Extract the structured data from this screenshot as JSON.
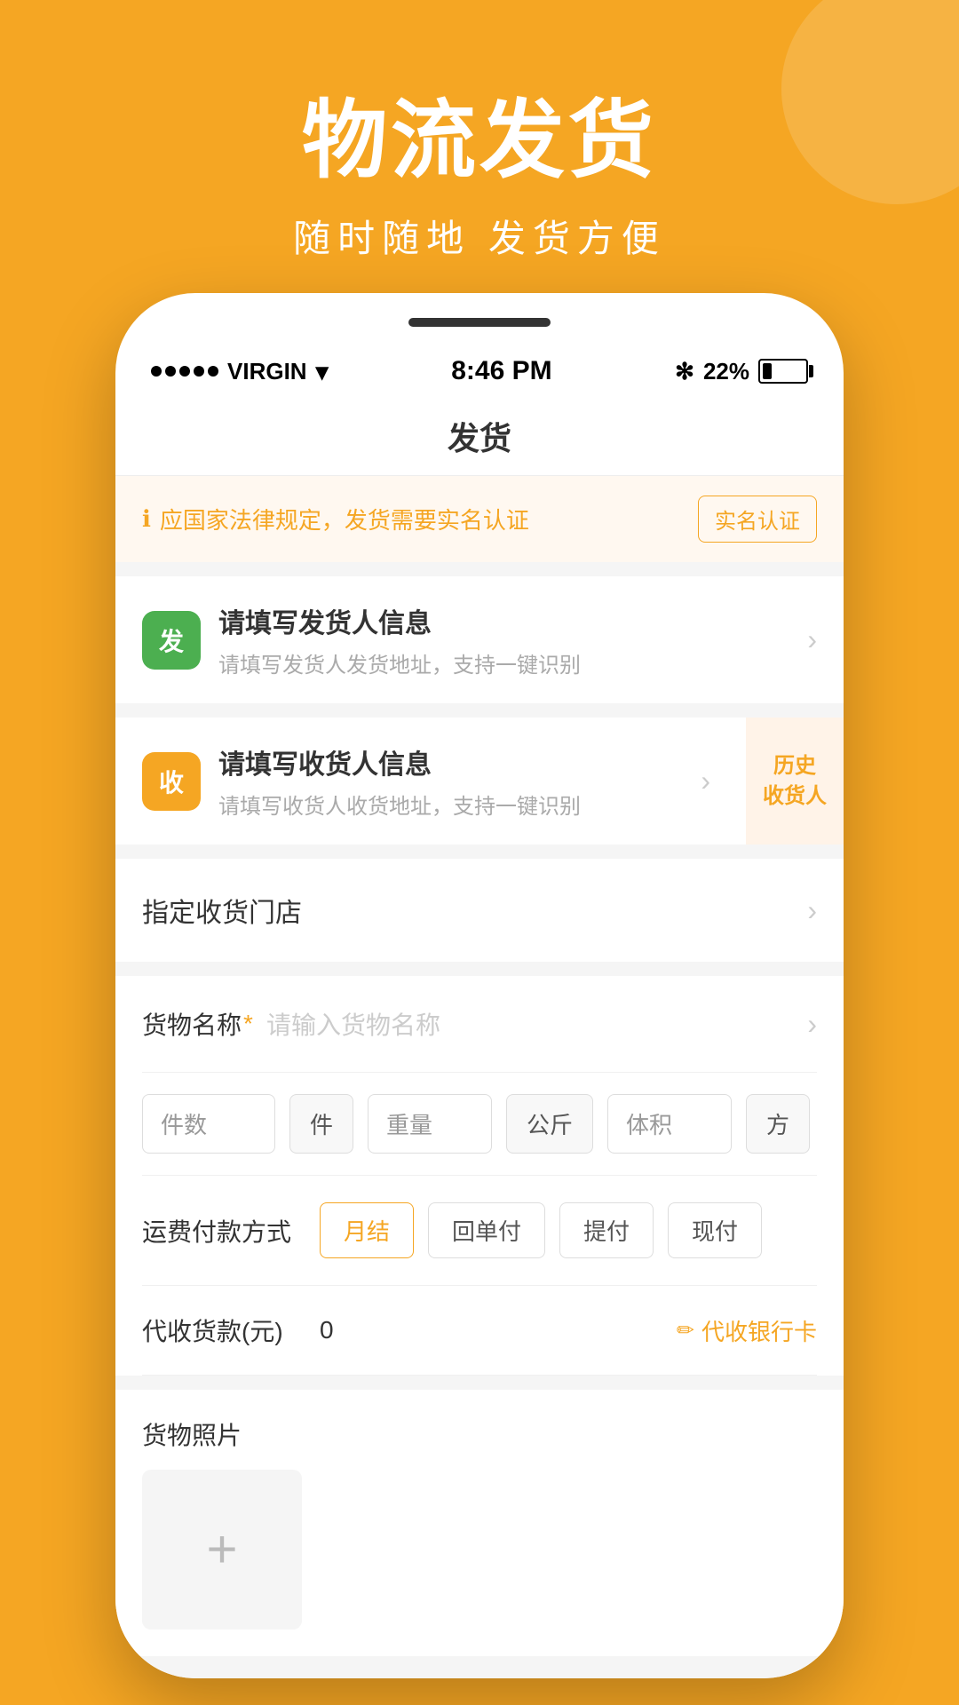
{
  "background_color": "#F5A623",
  "header": {
    "title": "物流发货",
    "subtitle": "随时随地  发货方便"
  },
  "status_bar": {
    "carrier": "VIRGIN",
    "time": "8:46 PM",
    "bluetooth": "B",
    "battery_percent": "22%"
  },
  "nav": {
    "title": "发货"
  },
  "notice": {
    "text": "应国家法律规定，发货需要实名认证",
    "button": "实名认证"
  },
  "sender_section": {
    "icon_label": "发",
    "title": "请填写发货人信息",
    "description": "请填写发货人发货地址，支持一键识别"
  },
  "receiver_section": {
    "icon_label": "收",
    "title": "请填写收货人信息",
    "description": "请填写收货人收货地址，支持一键识别",
    "history_button": "历史\n收货人"
  },
  "store_section": {
    "label": "指定收货门店"
  },
  "goods_section": {
    "name_label": "货物名称",
    "name_placeholder": "请输入货物名称",
    "count_placeholder": "件数",
    "count_unit": "件",
    "weight_placeholder": "重量",
    "weight_unit": "公斤",
    "volume_placeholder": "体积",
    "volume_unit": "方"
  },
  "payment_section": {
    "label": "运费付款方式",
    "options": [
      "月结",
      "回单付",
      "提付",
      "现付"
    ],
    "active_option": "月结"
  },
  "cod_section": {
    "label": "代收货款(元)",
    "value": "0",
    "bank_button": "代收银行卡"
  },
  "photo_section": {
    "label": "货物照片"
  }
}
